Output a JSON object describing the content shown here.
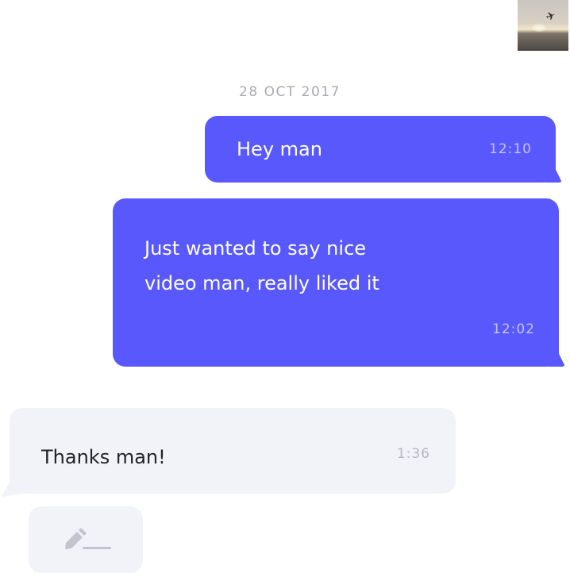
{
  "chat": {
    "date_divider": "28 OCT 2017",
    "messages": [
      {
        "direction": "outgoing",
        "text": "Hey man",
        "time": "12:10"
      },
      {
        "direction": "outgoing",
        "text": "Just wanted to say nice\nvideo man, really liked it",
        "time": "12:02"
      },
      {
        "direction": "incoming",
        "text": "Thanks man!",
        "time": "1:36"
      }
    ]
  },
  "compose": {
    "icon": "pencil-icon"
  },
  "avatar": {
    "icon": "profile-photo"
  },
  "colors": {
    "outgoing_bubble": "#5858fd",
    "incoming_bubble": "#f2f3f8",
    "date_text": "#a9a9b4"
  }
}
